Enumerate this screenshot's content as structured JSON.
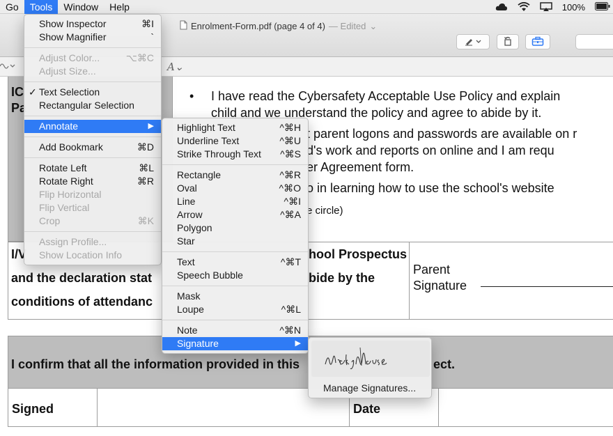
{
  "menubar": {
    "items": [
      "Go",
      "Tools",
      "Window",
      "Help"
    ],
    "active": "Tools",
    "battery": "100%"
  },
  "window": {
    "title": "Enrolment-Form.pdf (page 4 of 4)",
    "edited": "— Edited",
    "edited_chevron": "⌄",
    "markup_tool": "A⌄"
  },
  "document": {
    "top_left_lines": [
      "IC",
      "Pa"
    ],
    "bullet_lines": [
      "I have read the Cybersafety Acceptable Use Policy and explain",
      "child and we understand the policy and agree to abide by it.",
      "t parent logons and passwords are available on r",
      "d's work and reports on            online and I am requ",
      "er Agreement form.",
      "o in learning how to use the school's website",
      "e circle)"
    ],
    "bullet_mark": "•",
    "declaration_lines": [
      "I/V",
      "and the declaration stat",
      "conditions of attendanc"
    ],
    "declaration_right_lines": [
      "hool Prospectus",
      "bide by the"
    ],
    "parent_label_1": "Parent",
    "parent_label_2": "Signature",
    "confirm_left": "I confirm that all the information provided in this",
    "confirm_right": "ect.",
    "signed_label": "Signed",
    "date_label": "Date"
  },
  "tools_menu": {
    "groups": [
      [
        {
          "label": "Show Inspector",
          "shortcut": "⌘I"
        },
        {
          "label": "Show Magnifier",
          "shortcut": "`"
        }
      ],
      [
        {
          "label": "Adjust Color...",
          "shortcut": "⌥⌘C",
          "disabled": true
        },
        {
          "label": "Adjust Size...",
          "shortcut": "",
          "disabled": true
        }
      ],
      [
        {
          "label": "Text Selection",
          "shortcut": "",
          "checked": true
        },
        {
          "label": "Rectangular Selection",
          "shortcut": ""
        }
      ],
      [
        {
          "label": "Annotate",
          "shortcut": "",
          "submenu": true,
          "highlighted": true
        }
      ],
      [
        {
          "label": "Add Bookmark",
          "shortcut": "⌘D"
        }
      ],
      [
        {
          "label": "Rotate Left",
          "shortcut": "⌘L"
        },
        {
          "label": "Rotate Right",
          "shortcut": "⌘R"
        },
        {
          "label": "Flip Horizontal",
          "shortcut": "",
          "disabled": true
        },
        {
          "label": "Flip Vertical",
          "shortcut": "",
          "disabled": true
        },
        {
          "label": "Crop",
          "shortcut": "⌘K",
          "disabled": true
        }
      ],
      [
        {
          "label": "Assign Profile...",
          "shortcut": "",
          "disabled": true
        },
        {
          "label": "Show Location Info",
          "shortcut": "",
          "disabled": true
        }
      ]
    ]
  },
  "annotate_menu": {
    "groups": [
      [
        {
          "label": "Highlight Text",
          "shortcut": "^⌘H"
        },
        {
          "label": "Underline Text",
          "shortcut": "^⌘U"
        },
        {
          "label": "Strike Through Text",
          "shortcut": "^⌘S"
        }
      ],
      [
        {
          "label": "Rectangle",
          "shortcut": "^⌘R"
        },
        {
          "label": "Oval",
          "shortcut": "^⌘O"
        },
        {
          "label": "Line",
          "shortcut": "^⌘I"
        },
        {
          "label": "Arrow",
          "shortcut": "^⌘A"
        },
        {
          "label": "Polygon",
          "shortcut": ""
        },
        {
          "label": "Star",
          "shortcut": ""
        }
      ],
      [
        {
          "label": "Text",
          "shortcut": "^⌘T"
        },
        {
          "label": "Speech Bubble",
          "shortcut": ""
        }
      ],
      [
        {
          "label": "Mask",
          "shortcut": ""
        },
        {
          "label": "Loupe",
          "shortcut": "^⌘L"
        }
      ],
      [
        {
          "label": "Note",
          "shortcut": "^⌘N"
        },
        {
          "label": "Signature",
          "shortcut": "",
          "submenu": true,
          "highlighted": true
        }
      ]
    ]
  },
  "signature_menu": {
    "signature_text": "Mickey Mouse",
    "manage_label": "Manage Signatures..."
  },
  "colors": {
    "accent": "#2f7bf5",
    "menu_bg": "#eeeeee",
    "table_grey": "#bdbdbd"
  },
  "icons": [
    "icloud-icon",
    "wifi-icon",
    "airplay-icon",
    "battery-icon",
    "pdf-file-icon",
    "pen-markup-icon",
    "rotate-icon",
    "toolbox-icon",
    "submenu-arrow-icon",
    "checkmark-icon"
  ]
}
